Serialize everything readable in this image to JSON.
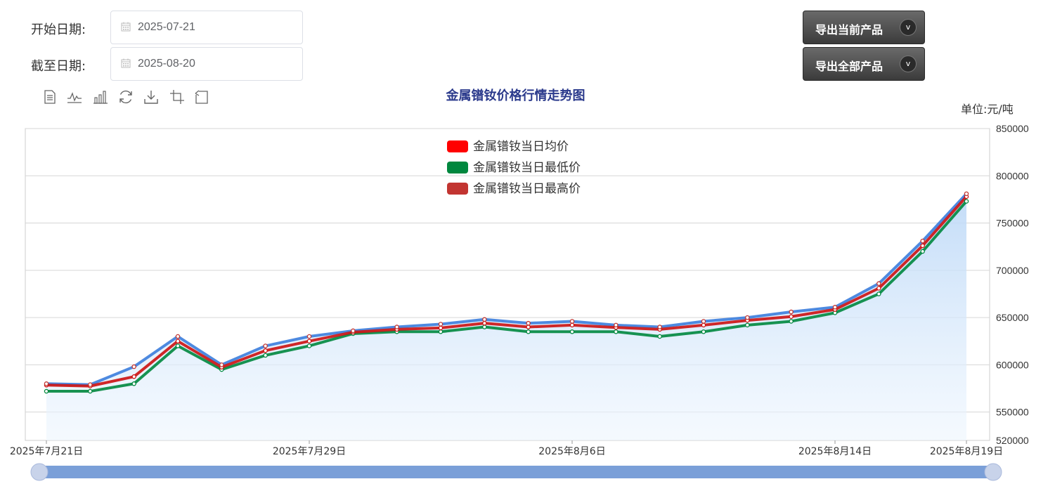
{
  "form": {
    "start_label": "开始日期:",
    "start_value": "2025-07-21",
    "end_label": "截至日期:",
    "end_value": "2025-08-20"
  },
  "buttons": {
    "export_current": "导出当前产品",
    "export_all": "导出全部产品",
    "dropdown_glyph": "v"
  },
  "toolbox": [
    "data-view-icon",
    "line-chart-icon",
    "bar-chart-icon",
    "restore-icon",
    "download-icon",
    "zoom-icon",
    "zoom-reset-icon"
  ],
  "unit_label": "单位:元/吨",
  "chart_data": {
    "type": "line",
    "title": "金属镨钕价格行情走势图",
    "x": [
      "2025-07-21",
      "2025-07-22",
      "2025-07-23",
      "2025-07-24",
      "2025-07-25",
      "2025-07-28",
      "2025-07-29",
      "2025-07-30",
      "2025-07-31",
      "2025-08-01",
      "2025-08-04",
      "2025-08-05",
      "2025-08-06",
      "2025-08-07",
      "2025-08-08",
      "2025-08-11",
      "2025-08-12",
      "2025-08-13",
      "2025-08-14",
      "2025-08-15",
      "2025-08-18",
      "2025-08-19"
    ],
    "x_tick_labels": [
      {
        "index": 0,
        "label": "2025年7月21日"
      },
      {
        "index": 6,
        "label": "2025年7月29日"
      },
      {
        "index": 12,
        "label": "2025年8月6日"
      },
      {
        "index": 18,
        "label": "2025年8月14日"
      },
      {
        "index": 21,
        "label": "2025年8月19日"
      }
    ],
    "series": [
      {
        "name": "金属镨钕当日均价",
        "color": "#ff0000",
        "values": [
          578500,
          577500,
          587500,
          625000,
          597500,
          615000,
          625000,
          634500,
          637500,
          639000,
          644000,
          640000,
          642000,
          639500,
          637500,
          642000,
          647000,
          651000,
          658500,
          681000,
          726000,
          778000
        ]
      },
      {
        "name": "金属镨钕当日最低价",
        "color": "#00873e",
        "values": [
          572000,
          572000,
          580000,
          620000,
          595000,
          610000,
          620000,
          633000,
          635000,
          635000,
          640000,
          635000,
          635000,
          635000,
          630000,
          635000,
          642000,
          646000,
          655000,
          675000,
          720000,
          773000
        ]
      },
      {
        "name": "金属镨钕当日最高价",
        "color": "#c23531",
        "values": [
          580000,
          579000,
          598000,
          630000,
          600000,
          620000,
          630000,
          636000,
          640000,
          643000,
          648000,
          644000,
          646000,
          642000,
          640000,
          646000,
          650000,
          656000,
          661000,
          686000,
          731000,
          781000
        ]
      }
    ],
    "ylim": [
      520000,
      850000
    ],
    "y_ticks": [
      520000,
      550000,
      600000,
      650000,
      700000,
      750000,
      800000,
      850000
    ],
    "grid": true,
    "legend_position": "top-center",
    "area_fill": true,
    "datazoom_range": [
      0,
      100
    ]
  }
}
